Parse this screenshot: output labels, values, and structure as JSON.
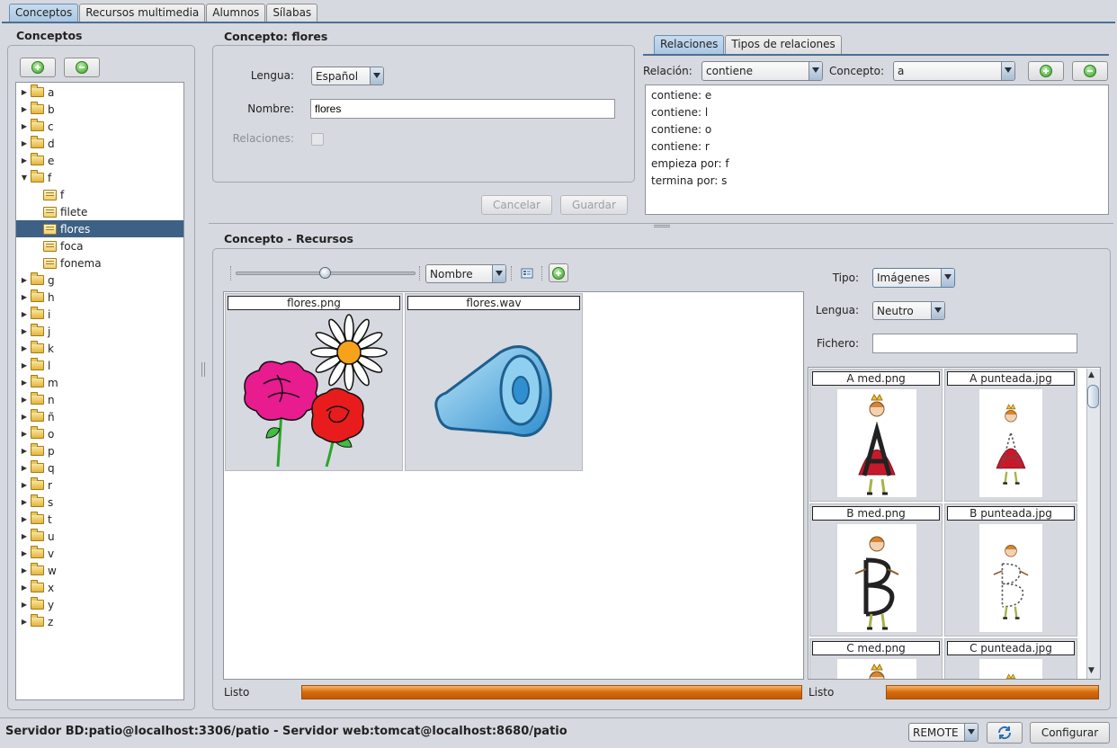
{
  "top_tabs": [
    "Conceptos",
    "Recursos multimedia",
    "Alumnos",
    "Sílabas"
  ],
  "left": {
    "title": "Conceptos",
    "tree": [
      {
        "label": "a",
        "type": "folder",
        "expanded": false
      },
      {
        "label": "b",
        "type": "folder",
        "expanded": false
      },
      {
        "label": "c",
        "type": "folder",
        "expanded": false
      },
      {
        "label": "d",
        "type": "folder",
        "expanded": false
      },
      {
        "label": "e",
        "type": "folder",
        "expanded": false
      },
      {
        "label": "f",
        "type": "folder",
        "expanded": true
      },
      {
        "label": "f",
        "type": "leaf"
      },
      {
        "label": "filete",
        "type": "leaf"
      },
      {
        "label": "flores",
        "type": "leaf",
        "selected": true
      },
      {
        "label": "foca",
        "type": "leaf"
      },
      {
        "label": "fonema",
        "type": "leaf"
      },
      {
        "label": "g",
        "type": "folder",
        "expanded": false
      },
      {
        "label": "h",
        "type": "folder",
        "expanded": false
      },
      {
        "label": "i",
        "type": "folder",
        "expanded": false
      },
      {
        "label": "j",
        "type": "folder",
        "expanded": false
      },
      {
        "label": "k",
        "type": "folder",
        "expanded": false
      },
      {
        "label": "l",
        "type": "folder",
        "expanded": false
      },
      {
        "label": "m",
        "type": "folder",
        "expanded": false
      },
      {
        "label": "n",
        "type": "folder",
        "expanded": false
      },
      {
        "label": "ñ",
        "type": "folder",
        "expanded": false
      },
      {
        "label": "o",
        "type": "folder",
        "expanded": false
      },
      {
        "label": "p",
        "type": "folder",
        "expanded": false
      },
      {
        "label": "q",
        "type": "folder",
        "expanded": false
      },
      {
        "label": "r",
        "type": "folder",
        "expanded": false
      },
      {
        "label": "s",
        "type": "folder",
        "expanded": false
      },
      {
        "label": "t",
        "type": "folder",
        "expanded": false
      },
      {
        "label": "u",
        "type": "folder",
        "expanded": false
      },
      {
        "label": "v",
        "type": "folder",
        "expanded": false
      },
      {
        "label": "w",
        "type": "folder",
        "expanded": false
      },
      {
        "label": "x",
        "type": "folder",
        "expanded": false
      },
      {
        "label": "y",
        "type": "folder",
        "expanded": false
      },
      {
        "label": "z",
        "type": "folder",
        "expanded": false
      }
    ]
  },
  "concept": {
    "title": "Concepto: flores",
    "lengua_label": "Lengua:",
    "lengua_value": "Español",
    "nombre_label": "Nombre:",
    "nombre_value": "flores",
    "relaciones_label": "Relaciones:",
    "cancel_label": "Cancelar",
    "save_label": "Guardar"
  },
  "relations": {
    "tabs": [
      "Relaciones",
      "Tipos de relaciones"
    ],
    "relacion_label": "Relación:",
    "relacion_value": "contiene",
    "concepto_label": "Concepto:",
    "concepto_value": "a",
    "items": [
      "contiene: e",
      "contiene: l",
      "contiene: o",
      "contiene: r",
      "empieza por: f",
      "termina por: s"
    ]
  },
  "resources": {
    "title": "Concepto - Recursos",
    "sort_value": "Nombre",
    "slider_level": 0.5,
    "items": [
      {
        "name": "flores.png",
        "icon": "flowers-image"
      },
      {
        "name": "flores.wav",
        "icon": "speaker-icon"
      }
    ],
    "status_text": "Listo"
  },
  "browser": {
    "tipo_label": "Tipo:",
    "tipo_value": "Imágenes",
    "lengua_label": "Lengua:",
    "lengua_value": "Neutro",
    "fichero_label": "Fichero:",
    "fichero_value": "",
    "thumbs": [
      {
        "name": "A med.png",
        "letter": "A"
      },
      {
        "name": "A punteada.jpg",
        "letter": "A"
      },
      {
        "name": "B med.png",
        "letter": "B"
      },
      {
        "name": "B punteada.jpg",
        "letter": "B"
      },
      {
        "name": "C med.png",
        "letter": "C"
      },
      {
        "name": "C punteada.jpg",
        "letter": "C"
      }
    ],
    "status_text": "Listo"
  },
  "status": {
    "server_text": "Servidor BD:patio@localhost:3306/patio - Servidor web:tomcat@localhost:8680/patio",
    "mode_value": "REMOTE",
    "configure_label": "Configurar"
  },
  "colors": {
    "selection": "#3d6185",
    "progress": "#d56a0b"
  }
}
